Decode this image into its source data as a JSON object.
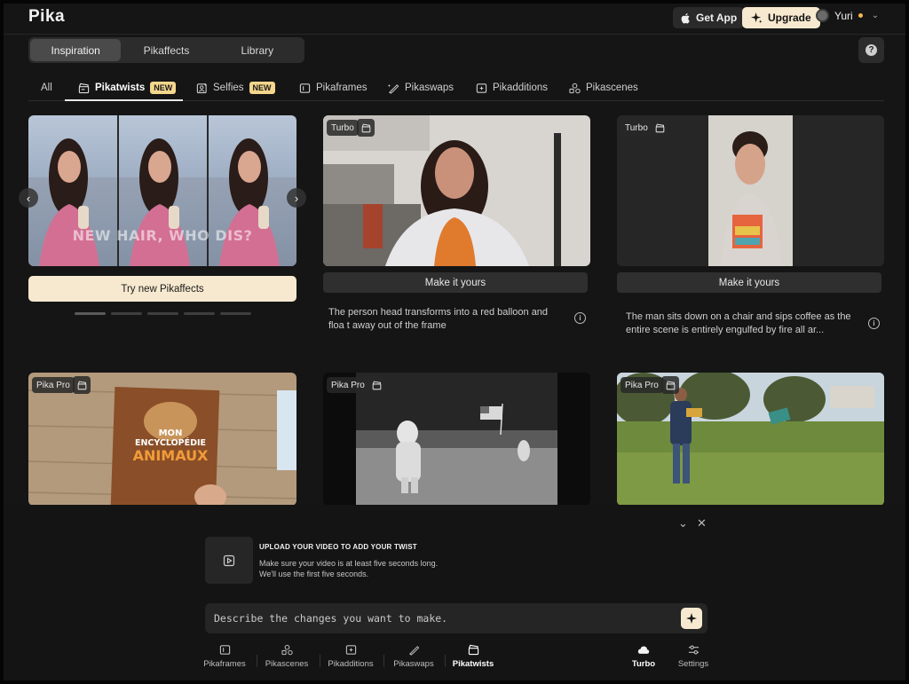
{
  "app": {
    "name": "Pika"
  },
  "header": {
    "get_app_label": "Get App",
    "upgrade_label": "Upgrade",
    "user_name": "Yuri",
    "user_status_color": "#f4b74d"
  },
  "main_tabs": [
    {
      "label": "Inspiration",
      "active": true
    },
    {
      "label": "Pikaffects",
      "active": false
    },
    {
      "label": "Library",
      "active": false
    }
  ],
  "help_label": "?",
  "categories": [
    {
      "label": "All",
      "icon": "none"
    },
    {
      "label": "Pikatwists",
      "icon": "clapper-icon",
      "badge": "NEW",
      "active": true
    },
    {
      "label": "Selfies",
      "icon": "selfie-icon",
      "badge": "NEW"
    },
    {
      "label": "Pikaframes",
      "icon": "frames-icon"
    },
    {
      "label": "Pikaswaps",
      "icon": "swap-icon"
    },
    {
      "label": "Pikadditions",
      "icon": "add-icon"
    },
    {
      "label": "Pikascenes",
      "icon": "scenes-icon"
    }
  ],
  "hero": {
    "overlay_text": "NEW HAIR, WHO DIS?",
    "button_label": "Try new Pikaffects",
    "prev": "‹",
    "next": "›",
    "pages": 5,
    "active_page": 0
  },
  "cards": [
    {
      "tag": "Turbo",
      "button": "Make it yours",
      "description": "The person head transforms into a red balloon and floa t away out of the frame",
      "info": "i"
    },
    {
      "tag": "Turbo",
      "button": "Make it yours",
      "description": "The man sits down on a chair and sips coffee as the entire scene is entirely engulfed by fire all ar...",
      "info": "i"
    },
    {
      "tag": "Pika Pro",
      "book_line1": "MON",
      "book_line2": "ENCYCLOPÉDIE",
      "book_line3": "ANIMAUX"
    },
    {
      "tag": "Pika Pro"
    },
    {
      "tag": "Pika Pro"
    }
  ],
  "composer": {
    "collapse": "⌄",
    "close": "✕",
    "upload_title": "UPLOAD YOUR VIDEO TO ADD YOUR TWIST",
    "upload_line1": "Make sure your video is at least five seconds long.",
    "upload_line2": "We'll use the first five seconds.",
    "prompt_placeholder": "Describe the changes you want to make."
  },
  "tools": [
    {
      "label": "Pikaframes"
    },
    {
      "label": "Pikascenes"
    },
    {
      "label": "Pikadditions"
    },
    {
      "label": "Pikaswaps"
    },
    {
      "label": "Pikatwists",
      "active": true
    },
    {
      "label": "Turbo",
      "active": true
    },
    {
      "label": "Settings"
    }
  ],
  "colors": {
    "accent": "#f7e9cf",
    "badge": "#f4d68d",
    "background": "#151515"
  }
}
